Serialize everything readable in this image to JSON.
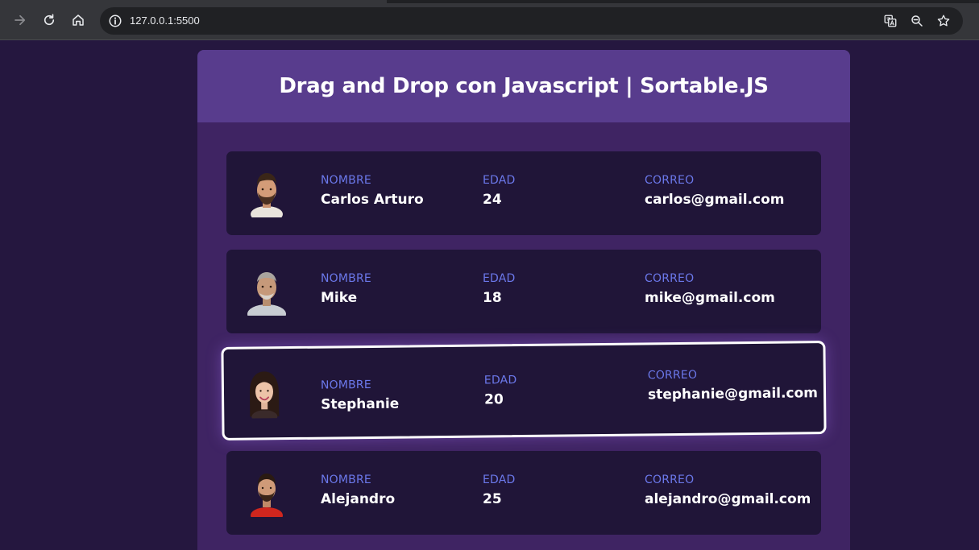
{
  "browser": {
    "url": "127.0.0.1:5500",
    "icons": [
      "forward-icon",
      "reload-icon",
      "home-icon",
      "info-icon",
      "translate-icon",
      "zoom-icon",
      "bookmark-star-icon"
    ]
  },
  "page": {
    "title": "Drag and Drop con Javascript | Sortable.JS",
    "labels": {
      "name": "NOMBRE",
      "age": "EDAD",
      "email": "CORREO"
    },
    "users": [
      {
        "name": "Carlos Arturo",
        "age": "24",
        "email": "carlos@gmail.com",
        "dragging": false
      },
      {
        "name": "Mike",
        "age": "18",
        "email": "mike@gmail.com",
        "dragging": false
      },
      {
        "name": "Stephanie",
        "age": "20",
        "email": "stephanie@gmail.com",
        "dragging": true
      },
      {
        "name": "Alejandro",
        "age": "25",
        "email": "alejandro@gmail.com",
        "dragging": false
      }
    ]
  },
  "colors": {
    "background": "#25173f",
    "panel": "#3f2463",
    "header": "#583c8d",
    "card": "#201538",
    "label": "#6b78ea"
  }
}
